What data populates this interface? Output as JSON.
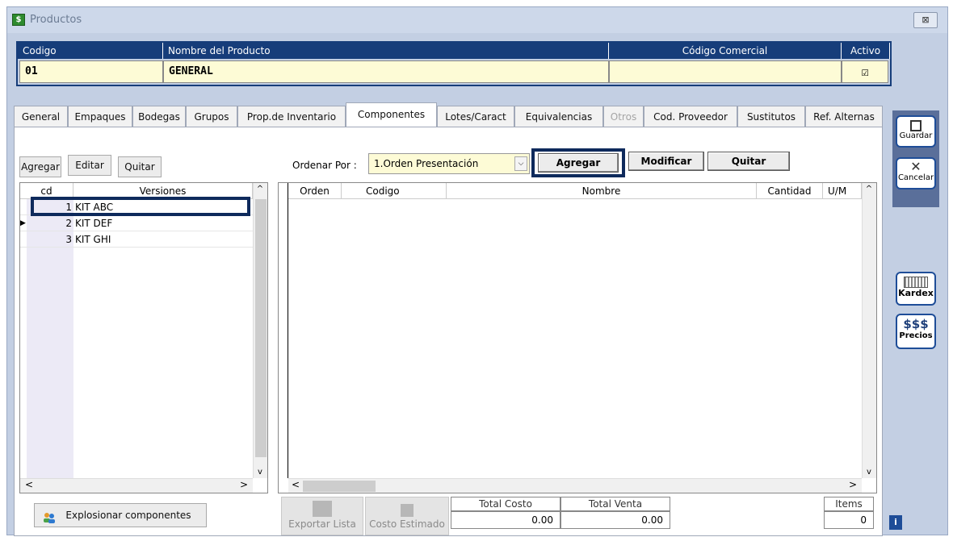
{
  "window": {
    "title": "Productos",
    "close_glyph": "⊠"
  },
  "header": {
    "codigo_label": "Codigo",
    "nombre_label": "Nombre del Producto",
    "comercial_label": "Código Comercial",
    "activo_label": "Activo",
    "codigo_value": "01",
    "nombre_value": "GENERAL",
    "comercial_value": "",
    "activo_checked": "☑"
  },
  "tabs": [
    {
      "label": "General"
    },
    {
      "label": "Empaques"
    },
    {
      "label": "Bodegas"
    },
    {
      "label": "Grupos"
    },
    {
      "label": "Prop.de Inventario"
    },
    {
      "label": "Componentes"
    },
    {
      "label": "Lotes/Caract"
    },
    {
      "label": "Equivalencias"
    },
    {
      "label": "Otros"
    },
    {
      "label": "Cod. Proveedor"
    },
    {
      "label": "Sustitutos"
    },
    {
      "label": "Ref. Alternas"
    }
  ],
  "versions_toolbar": {
    "agregar": "Agregar",
    "editar": "Editar",
    "quitar": "Quitar"
  },
  "sort": {
    "label": "Ordenar Por :",
    "value": "1.Orden Presentación"
  },
  "components_toolbar": {
    "agregar": "Agregar",
    "modificar": "Modificar",
    "quitar": "Quitar"
  },
  "versions_table": {
    "headers": [
      "cd",
      "Versiones"
    ],
    "rows": [
      {
        "cd": "1",
        "name": "KIT ABC"
      },
      {
        "cd": "2",
        "name": "KIT DEF"
      },
      {
        "cd": "3",
        "name": "KIT GHI"
      }
    ]
  },
  "components_table": {
    "headers": [
      "Orden",
      "Codigo",
      "Nombre",
      "Cantidad",
      "U/M"
    ]
  },
  "footer": {
    "explosionar": "Explosionar componentes",
    "exportar": "Exportar Lista",
    "costo_estimado": "Costo Estimado",
    "total_costo_label": "Total Costo",
    "total_venta_label": "Total Venta",
    "items_label": "Items",
    "total_costo": "0.00",
    "total_venta": "0.00",
    "items": "0"
  },
  "sidebar": {
    "guardar": "Guardar",
    "cancelar": "Cancelar",
    "kardex": "Kardex",
    "precios_symbol": "$$$",
    "precios": "Precios"
  },
  "colors": {
    "header_bg": "#163d7a",
    "value_bg": "#fdfbd6",
    "window_bg": "#c3cfe3"
  }
}
